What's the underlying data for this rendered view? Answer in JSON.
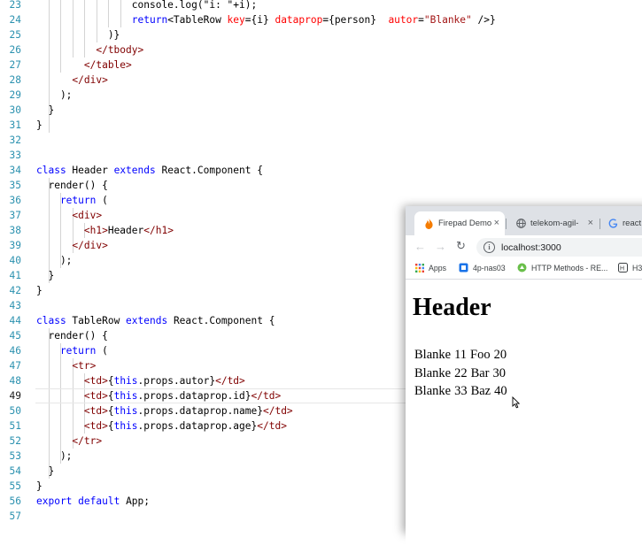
{
  "editor": {
    "active_line": "49",
    "lines": [
      {
        "num": "23",
        "tokens": [
          [
            "",
            "                console.log(\"i: \"+i);"
          ]
        ]
      },
      {
        "num": "24",
        "tokens": [
          [
            "kw",
            "                return"
          ],
          [
            "",
            "<TableRow "
          ],
          [
            "attr",
            "key"
          ],
          [
            "",
            "={i} "
          ],
          [
            "attr",
            "dataprop"
          ],
          [
            "",
            "={person}  "
          ],
          [
            "attr",
            "autor"
          ],
          [
            "",
            "="
          ],
          [
            "str",
            "\"Blanke\""
          ],
          [
            "",
            " />}"
          ]
        ]
      },
      {
        "num": "25",
        "tokens": [
          [
            "",
            "            )}"
          ]
        ]
      },
      {
        "num": "26",
        "tokens": [
          [
            "tag",
            "          </tbody>"
          ]
        ]
      },
      {
        "num": "27",
        "tokens": [
          [
            "tag",
            "        </table>"
          ]
        ]
      },
      {
        "num": "28",
        "tokens": [
          [
            "tag",
            "      </div>"
          ]
        ]
      },
      {
        "num": "29",
        "tokens": [
          [
            "",
            "    );"
          ]
        ]
      },
      {
        "num": "30",
        "tokens": [
          [
            "",
            "  }"
          ]
        ]
      },
      {
        "num": "31",
        "tokens": [
          [
            "",
            "}"
          ]
        ]
      },
      {
        "num": "32",
        "tokens": []
      },
      {
        "num": "33",
        "tokens": []
      },
      {
        "num": "34",
        "tokens": [
          [
            "kw",
            "class"
          ],
          [
            "",
            " Header "
          ],
          [
            "kw",
            "extends"
          ],
          [
            "",
            " React.Component {"
          ]
        ]
      },
      {
        "num": "35",
        "tokens": [
          [
            "",
            "  render() {"
          ]
        ]
      },
      {
        "num": "36",
        "tokens": [
          [
            "kw",
            "    return"
          ],
          [
            "",
            " ("
          ]
        ]
      },
      {
        "num": "37",
        "tokens": [
          [
            "tag",
            "      <div>"
          ]
        ]
      },
      {
        "num": "38",
        "tokens": [
          [
            "tag",
            "        <h1>"
          ],
          [
            "",
            "Header"
          ],
          [
            "tag",
            "</h1>"
          ]
        ]
      },
      {
        "num": "39",
        "tokens": [
          [
            "tag",
            "      </div>"
          ]
        ]
      },
      {
        "num": "40",
        "tokens": [
          [
            "",
            "    );"
          ]
        ]
      },
      {
        "num": "41",
        "tokens": [
          [
            "",
            "  }"
          ]
        ]
      },
      {
        "num": "42",
        "tokens": [
          [
            "",
            "}"
          ]
        ]
      },
      {
        "num": "43",
        "tokens": []
      },
      {
        "num": "44",
        "tokens": [
          [
            "kw",
            "class"
          ],
          [
            "",
            " TableRow "
          ],
          [
            "kw",
            "extends"
          ],
          [
            "",
            " React.Component {"
          ]
        ]
      },
      {
        "num": "45",
        "tokens": [
          [
            "",
            "  render() {"
          ]
        ]
      },
      {
        "num": "46",
        "tokens": [
          [
            "kw",
            "    return"
          ],
          [
            "",
            " ("
          ]
        ]
      },
      {
        "num": "47",
        "tokens": [
          [
            "tag",
            "      <tr>"
          ]
        ]
      },
      {
        "num": "48",
        "tokens": [
          [
            "tag",
            "        <td>"
          ],
          [
            "",
            "{"
          ],
          [
            "kw",
            "this"
          ],
          [
            "",
            ".props.autor}"
          ],
          [
            "tag",
            "</td>"
          ]
        ]
      },
      {
        "num": "49",
        "tokens": [
          [
            "tag",
            "        <td>"
          ],
          [
            "",
            "{"
          ],
          [
            "kw",
            "this"
          ],
          [
            "",
            ".props.dataprop.id}"
          ],
          [
            "tag",
            "</td>"
          ]
        ]
      },
      {
        "num": "50",
        "tokens": [
          [
            "tag",
            "        <td>"
          ],
          [
            "",
            "{"
          ],
          [
            "kw",
            "this"
          ],
          [
            "",
            ".props.dataprop.name}"
          ],
          [
            "tag",
            "</td>"
          ]
        ]
      },
      {
        "num": "51",
        "tokens": [
          [
            "tag",
            "        <td>"
          ],
          [
            "",
            "{"
          ],
          [
            "kw",
            "this"
          ],
          [
            "",
            ".props.dataprop.age}"
          ],
          [
            "tag",
            "</td>"
          ]
        ]
      },
      {
        "num": "52",
        "tokens": [
          [
            "tag",
            "      </tr>"
          ]
        ]
      },
      {
        "num": "53",
        "tokens": [
          [
            "",
            "    );"
          ]
        ]
      },
      {
        "num": "54",
        "tokens": [
          [
            "",
            "  }"
          ]
        ]
      },
      {
        "num": "55",
        "tokens": [
          [
            "",
            "}"
          ]
        ]
      },
      {
        "num": "56",
        "tokens": [
          [
            "kw",
            "export"
          ],
          [
            "",
            " "
          ],
          [
            "kw",
            "default"
          ],
          [
            "",
            " App;"
          ]
        ]
      },
      {
        "num": "57",
        "tokens": []
      }
    ]
  },
  "browser": {
    "tabs": [
      {
        "title": "Firepad Demo",
        "icon": "firepad-flame-icon",
        "close": "×"
      },
      {
        "title": "telekom-agil-",
        "icon": "globe-icon",
        "close": "×"
      },
      {
        "title": "react",
        "icon": "google-g-icon",
        "close": ""
      }
    ],
    "url": "localhost:3000",
    "bookmarks": [
      {
        "label": "Apps",
        "icon": "apps-grid-icon"
      },
      {
        "label": "4p-nas03",
        "icon": "nas-icon"
      },
      {
        "label": "HTTP Methods - RE...",
        "icon": "leaf-icon"
      },
      {
        "label": "H3",
        "icon": "h3-icon"
      }
    ],
    "page": {
      "heading": "Header",
      "rows": [
        [
          "Blanke",
          "11",
          "Foo",
          "20"
        ],
        [
          "Blanke",
          "22",
          "Bar",
          "30"
        ],
        [
          "Blanke",
          "33",
          "Baz",
          "40"
        ]
      ]
    }
  },
  "colors": {
    "keyword": "#0000ff",
    "tag": "#800000",
    "attribute": "#ff0000",
    "string": "#a31515",
    "line_number": "#2b91af"
  }
}
